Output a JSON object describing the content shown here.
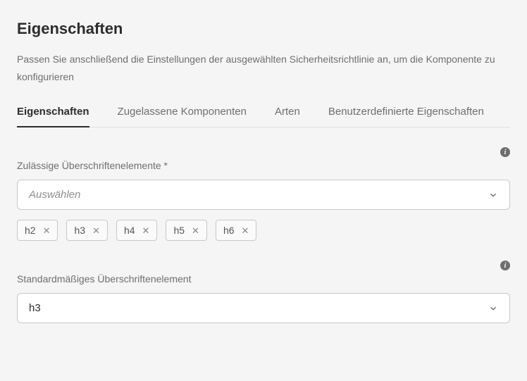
{
  "header": {
    "title": "Eigenschaften",
    "description": "Passen Sie anschließend die Einstellungen der ausgewählten Sicherheitsrichtlinie an, um die Komponente zu konfigurieren"
  },
  "tabs": [
    {
      "label": "Eigenschaften",
      "active": true
    },
    {
      "label": "Zugelassene Komponenten",
      "active": false
    },
    {
      "label": "Arten",
      "active": false
    },
    {
      "label": "Benutzerdefinierte Eigenschaften",
      "active": false
    }
  ],
  "fields": {
    "allowed_headings": {
      "label": "Zulässige Überschriftenelemente *",
      "placeholder": "Auswählen",
      "chips": [
        "h2",
        "h3",
        "h4",
        "h5",
        "h6"
      ]
    },
    "default_heading": {
      "label": "Standardmäßiges Überschriftenelement",
      "value": "h3"
    }
  }
}
